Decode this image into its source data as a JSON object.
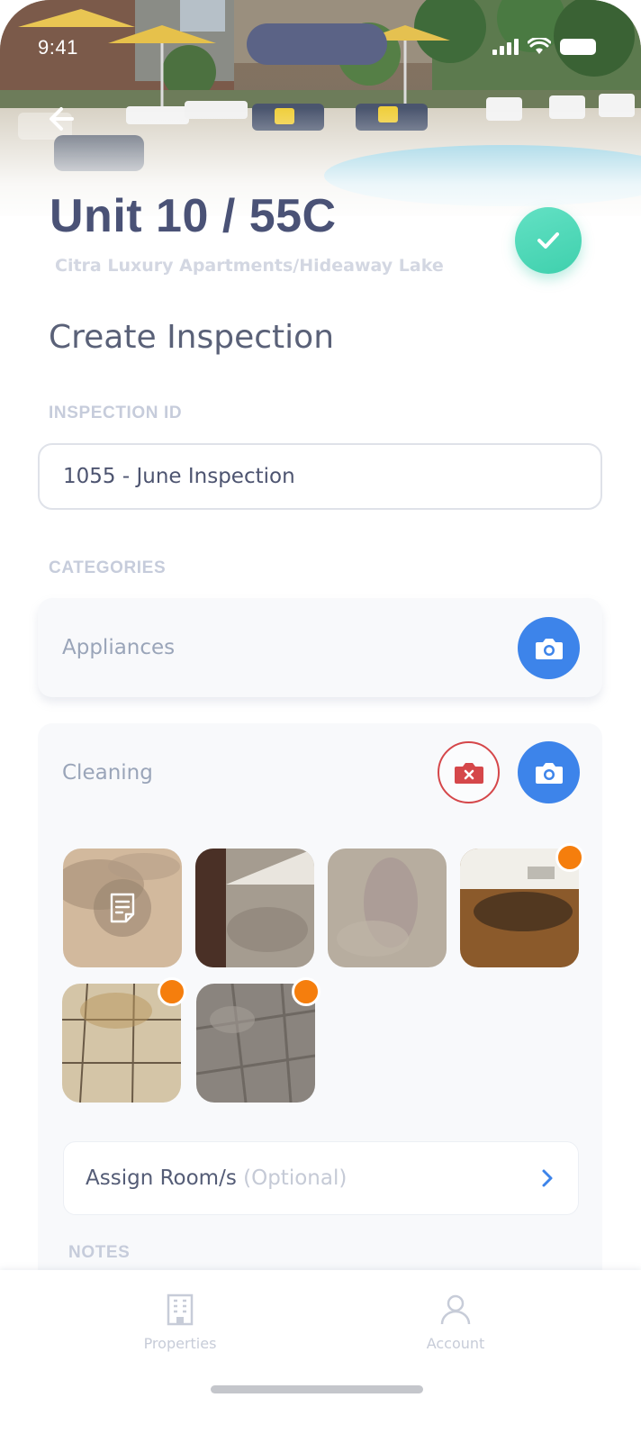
{
  "status_bar": {
    "time": "9:41"
  },
  "header": {
    "unit_title": "Unit 10 / 55C",
    "property": "Citra Luxury Apartments/Hideaway Lake"
  },
  "page": {
    "title": "Create Inspection"
  },
  "inspection_id": {
    "label": "INSPECTION ID",
    "value": "1055 - June Inspection"
  },
  "categories": {
    "label": "CATEGORIES",
    "items": [
      {
        "name": "Appliances"
      },
      {
        "name": "Cleaning"
      }
    ]
  },
  "assign_rooms": {
    "label": "Assign Room/s",
    "optional": "(Optional)"
  },
  "notes": {
    "label": "NOTES"
  },
  "tabbar": {
    "properties": "Properties",
    "account": "Account"
  },
  "colors": {
    "accent_blue": "#3d84ea",
    "confirm_green": "#4fd9b8",
    "flag_orange": "#f57e0d",
    "delete_red": "#d5474a",
    "title_navy": "#4a5276"
  },
  "icons": [
    "back-arrow-icon",
    "checkmark-icon",
    "camera-icon",
    "camera-delete-icon",
    "note-icon",
    "chevron-right-icon",
    "building-icon",
    "person-icon"
  ]
}
